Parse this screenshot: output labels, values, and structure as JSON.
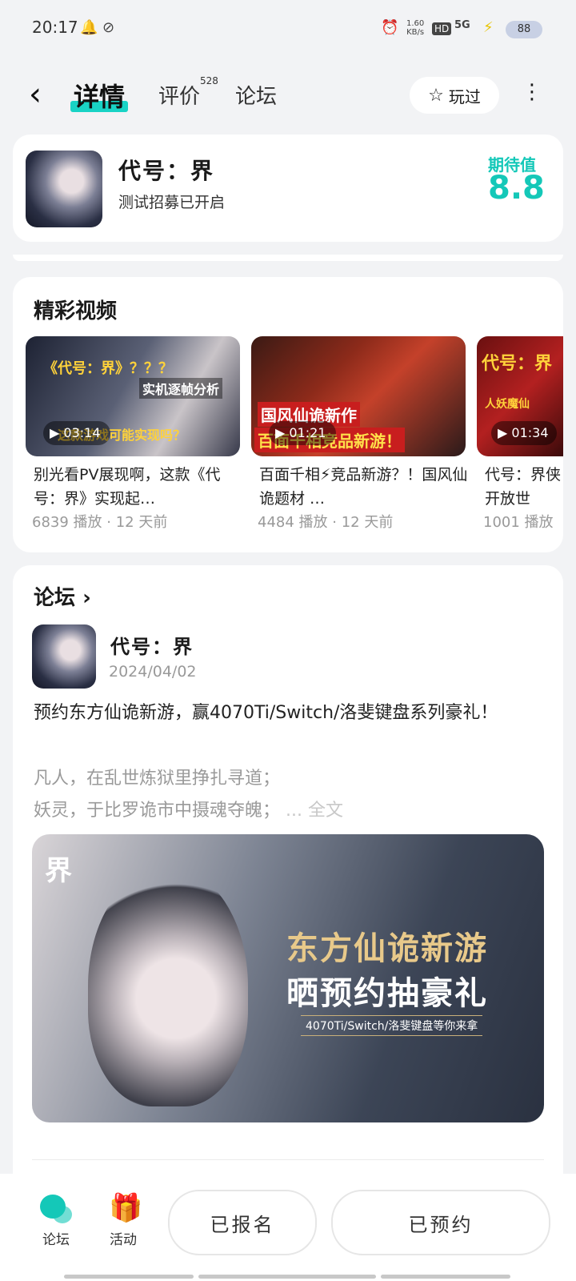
{
  "status_bar": {
    "time": "20:17",
    "net_speed": "1.60",
    "net_speed_unit": "KB/s",
    "hd": "HD",
    "signal": "5G",
    "battery": "88"
  },
  "header": {
    "tabs": [
      {
        "label": "详情"
      },
      {
        "label": "评价",
        "badge": "528"
      },
      {
        "label": "论坛"
      }
    ],
    "played_label": "玩过"
  },
  "game": {
    "title": "代号：界",
    "subtitle": "测试招募已开启",
    "expect_label": "期待值",
    "expect_value": "8.8"
  },
  "videos": {
    "section_title": "精彩视频",
    "items": [
      {
        "duration": "03:14",
        "title": "别光看PV展现啊，这款《代号：界》实现起…",
        "views": "6839 播放",
        "age": "12 天前",
        "thumb_lines": [
          "《代号：界》？？？",
          "实机逐帧分析",
          "这款游戏可能实现吗？"
        ]
      },
      {
        "duration": "01:21",
        "title": "百面千相⚡竞品新游？！国风仙诡题材 …",
        "views": "4484 播放",
        "age": "12 天前",
        "thumb_lines": [
          "国风仙诡新作",
          "百面千相竞品新游！"
        ]
      },
      {
        "duration": "01:34",
        "title": "代号：界侠开放世",
        "views": "1001 播放",
        "age": "",
        "thumb_lines": [
          "代号：界",
          "人妖魔仙"
        ]
      }
    ]
  },
  "forum": {
    "section_title": "论坛",
    "post": {
      "author": "代号：界",
      "date": "2024/04/02",
      "title": "预约东方仙诡新游，赢4070Ti/Switch/洛斐键盘系列豪礼！",
      "excerpt_line1": "凡人，在乱世炼狱里挣扎寻道；",
      "excerpt_line2": "妖灵，于比罗诡市中摄魂夺魄；",
      "more_label": "... 全文",
      "banner_logo": "界",
      "banner_line1": "东方仙诡新游",
      "banner_line2": "晒预约抽豪礼",
      "banner_line3": "4070Ti/Switch/洛斐键盘等你来拿"
    }
  },
  "bottom_bar": {
    "forum_label": "论坛",
    "activity_label": "活动",
    "registered_label": "已报名",
    "reserved_label": "已预约"
  },
  "colors": {
    "accent": "#14c8b8",
    "gift": "#f07a2e"
  }
}
